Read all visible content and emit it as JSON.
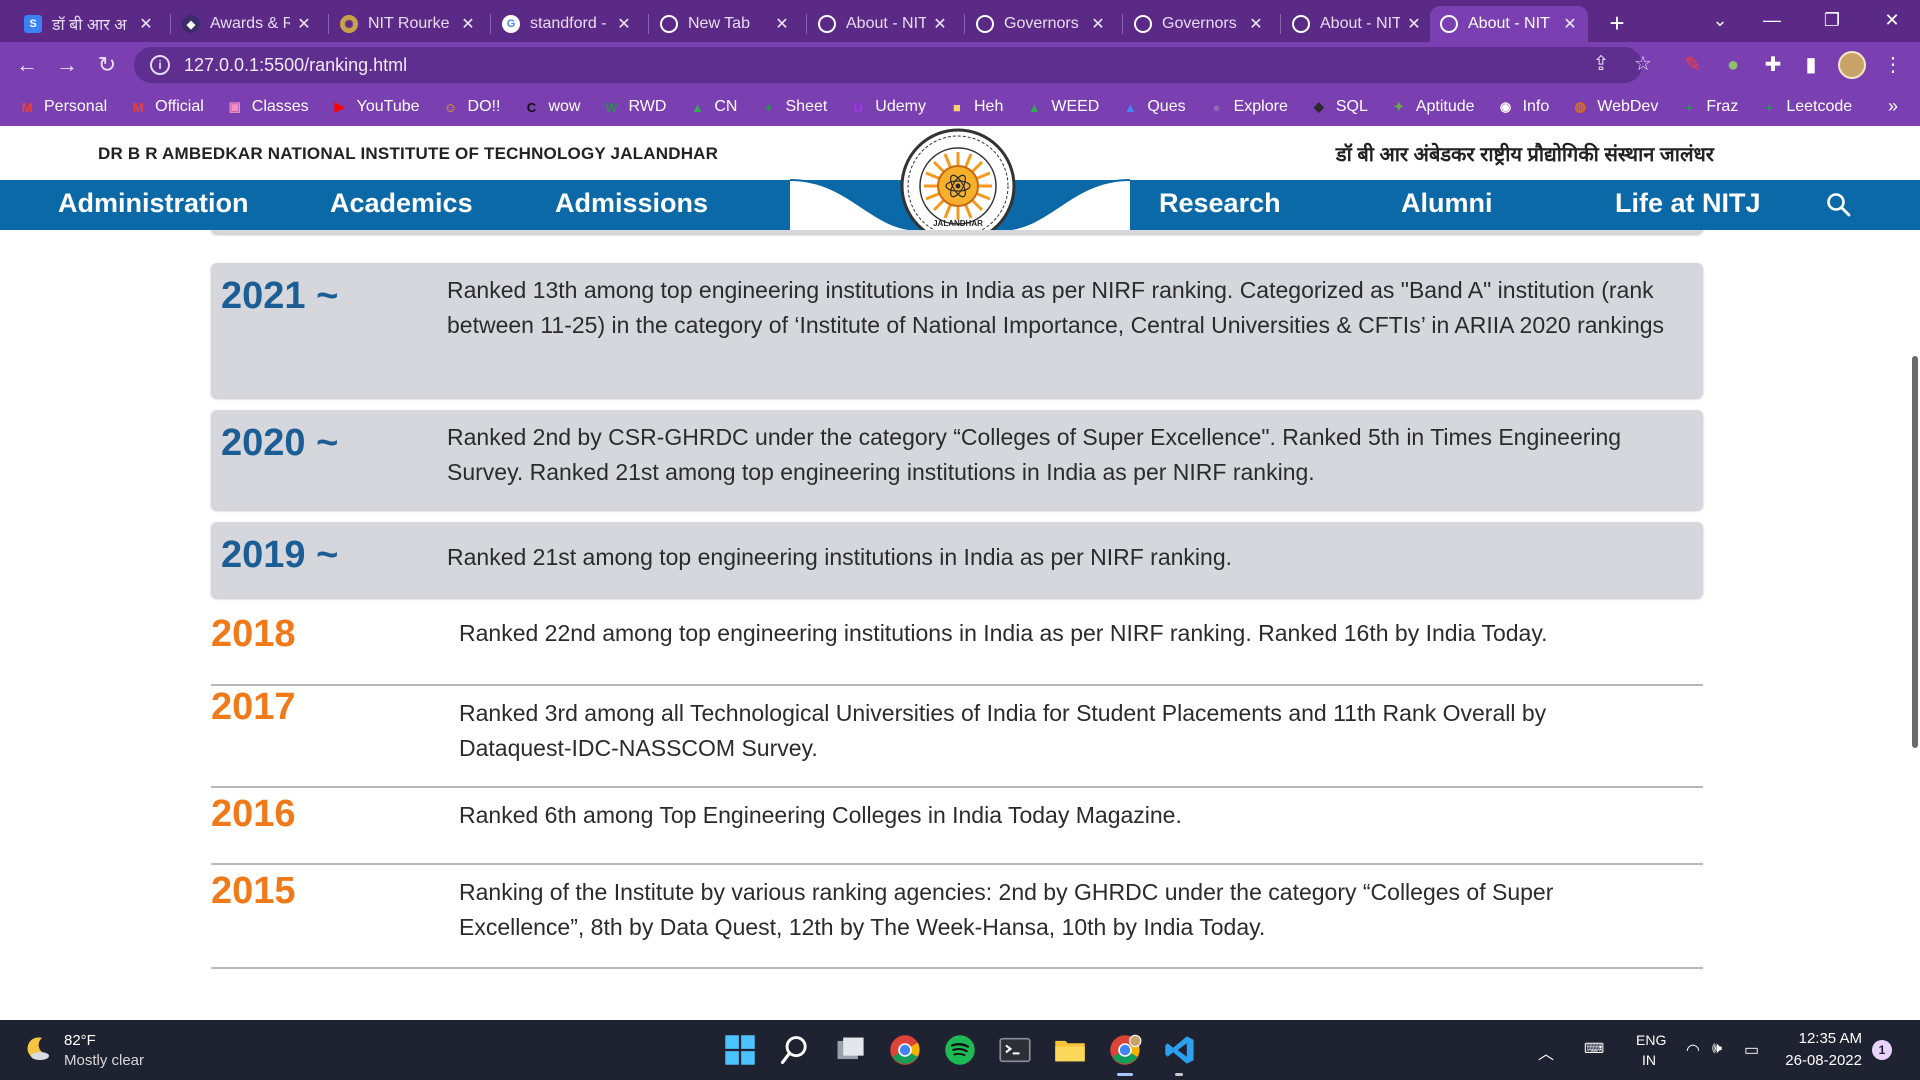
{
  "browser": {
    "tabs": [
      {
        "title": "डॉ बी आर अ",
        "favicon": "S",
        "active": false
      },
      {
        "title": "Awards & R",
        "favicon": "shield",
        "active": false
      },
      {
        "title": "NIT Rourke",
        "favicon": "emblem",
        "active": false
      },
      {
        "title": "standford -",
        "favicon": "G",
        "active": false
      },
      {
        "title": "New Tab",
        "favicon": "globe",
        "active": false
      },
      {
        "title": "About - NIT",
        "favicon": "globe",
        "active": false
      },
      {
        "title": "Governors",
        "favicon": "globe",
        "active": false
      },
      {
        "title": "Governors",
        "favicon": "globe",
        "active": false
      },
      {
        "title": "About - NIT",
        "favicon": "globe",
        "active": false
      },
      {
        "title": "About - NIT",
        "favicon": "globe",
        "active": true
      }
    ],
    "new_tab": "+",
    "url": "127.0.0.1:5500/ranking.html",
    "bookmarks": [
      {
        "label": "Personal",
        "icon": "gmail-icon",
        "color": "#ea4335"
      },
      {
        "label": "Official",
        "icon": "gmail-icon",
        "color": "#ea4335"
      },
      {
        "label": "Classes",
        "icon": "classroom-icon",
        "color": "#f28fc2"
      },
      {
        "label": "YouTube",
        "icon": "youtube-icon",
        "color": "#ff0000"
      },
      {
        "label": "DO!!",
        "icon": "emoji-icon",
        "color": "#f5b400"
      },
      {
        "label": "wow",
        "icon": "cnt-icon",
        "color": "#111111"
      },
      {
        "label": "RWD",
        "icon": "w-icon",
        "color": "#2e8b57"
      },
      {
        "label": "CN",
        "icon": "drive-icon",
        "color": "#34a853"
      },
      {
        "label": "Sheet",
        "icon": "plus-icon",
        "color": "#1e9e4a"
      },
      {
        "label": "Udemy",
        "icon": "udemy-icon",
        "color": "#a435f0"
      },
      {
        "label": "Heh",
        "icon": "folder-icon",
        "color": "#f7d46b"
      },
      {
        "label": "WEED",
        "icon": "drive-icon",
        "color": "#34a853"
      },
      {
        "label": "Ques",
        "icon": "drive-icon",
        "color": "#4285f4"
      },
      {
        "label": "Explore",
        "icon": "circle-icon",
        "color": "#8e6bb8"
      },
      {
        "label": "SQL",
        "icon": "hackerrank-icon",
        "color": "#2a2a2a"
      },
      {
        "label": "Aptitude",
        "icon": "aptitude-icon",
        "color": "#6aa84f"
      },
      {
        "label": "Info",
        "icon": "github-icon",
        "color": "#ffffff"
      },
      {
        "label": "WebDev",
        "icon": "webdev-icon",
        "color": "#e37400"
      },
      {
        "label": "Fraz",
        "icon": "plus-icon",
        "color": "#1e9e4a"
      },
      {
        "label": "Leetcode",
        "icon": "plus-icon",
        "color": "#1e9e4a"
      }
    ],
    "bookmarks_more": "»"
  },
  "site": {
    "institute_en": "DR B R AMBEDKAR NATIONAL INSTITUTE OF TECHNOLOGY JALANDHAR",
    "institute_hi": "डॉ बी आर अंबेडकर राष्ट्रीय प्रौद्योगिकी संस्थान जालंधर",
    "nav": [
      "Administration",
      "Academics",
      "Admissions",
      "Research",
      "Alumni",
      "Life at NITJ"
    ],
    "logo_text": "JALANDHAR",
    "colors": {
      "nav": "#0a69a6",
      "year_card": "#1b5e95",
      "year_plain": "#f07a1a",
      "card_bg": "#d6d7dc"
    }
  },
  "rankings": {
    "cards": [
      {
        "year": "2021 ~",
        "text": "Ranked 13th among top engineering institutions in India as per NIRF ranking. Categorized as \"Band A\" institution (rank between 11-25) in the category of ‘Institute of National Importance, Central Universities & CFTIs’ in ARIIA 2020 rankings"
      },
      {
        "year": "2020 ~",
        "text": "Ranked 2nd by CSR-GHRDC under the category “Colleges of Super Excellence\". Ranked 5th in Times Engineering Survey. Ranked 21st among top engineering institutions in India as per NIRF ranking."
      },
      {
        "year": "2019 ~",
        "text": "Ranked 21st among top engineering institutions in India as per NIRF ranking."
      }
    ],
    "rows": [
      {
        "year": "2018",
        "text": "Ranked 22nd among top engineering institutions in India as per NIRF ranking. Ranked 16th by India Today."
      },
      {
        "year": "2017",
        "text": "Ranked 3rd among all Technological Universities of India for Student Placements and 11th Rank Overall by Dataquest-IDC-NASSCOM Survey."
      },
      {
        "year": "2016",
        "text": "Ranked 6th among Top Engineering Colleges in India Today Magazine."
      },
      {
        "year": "2015",
        "text": "Ranking of the Institute by various ranking agencies: 2nd by GHRDC under the category “Colleges of Super Excellence”, 8th by Data Quest, 12th by The Week-Hansa, 10th by India Today."
      }
    ]
  },
  "taskbar": {
    "temperature": "82°F",
    "condition": "Mostly clear",
    "apps": [
      "windows-start-icon",
      "search-icon",
      "task-view-icon",
      "chrome-icon",
      "spotify-icon",
      "terminal-icon",
      "file-explorer-icon",
      "chrome-profile-icon",
      "vscode-icon"
    ],
    "lang_top": "ENG",
    "lang_bottom": "IN",
    "time": "12:35 AM",
    "date": "26-08-2022",
    "notifications": "1"
  }
}
